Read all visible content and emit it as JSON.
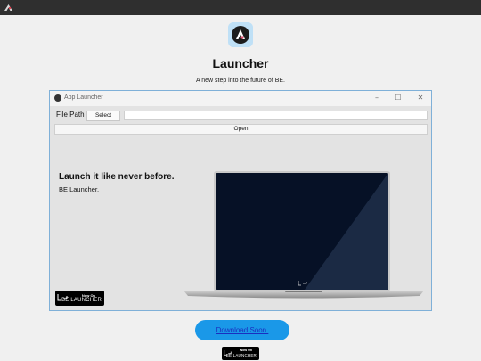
{
  "system_bar": {
    "icon": "app-icon"
  },
  "page": {
    "logo_icon": "launcher-logo-icon",
    "title": "Launcher",
    "subtitle": "A new step into the future of BE."
  },
  "window": {
    "title": "App Launcher",
    "controls": {
      "minimize": "–",
      "maximize": "☐",
      "close": "✕"
    },
    "file_path_label": "File Path",
    "select_label": "Select",
    "path_value": "",
    "open_label": "Open",
    "headline": "Launch it like never before.",
    "tagline": "BE Launcher."
  },
  "badge": {
    "top": "Now On",
    "main": "BE LAUNCHER"
  },
  "download": {
    "label": "Download Soon."
  },
  "colors": {
    "accent": "#1a98e8",
    "screen": "#061126",
    "topbar": "#2f2f2f",
    "window_border": "#7fb0d8"
  }
}
